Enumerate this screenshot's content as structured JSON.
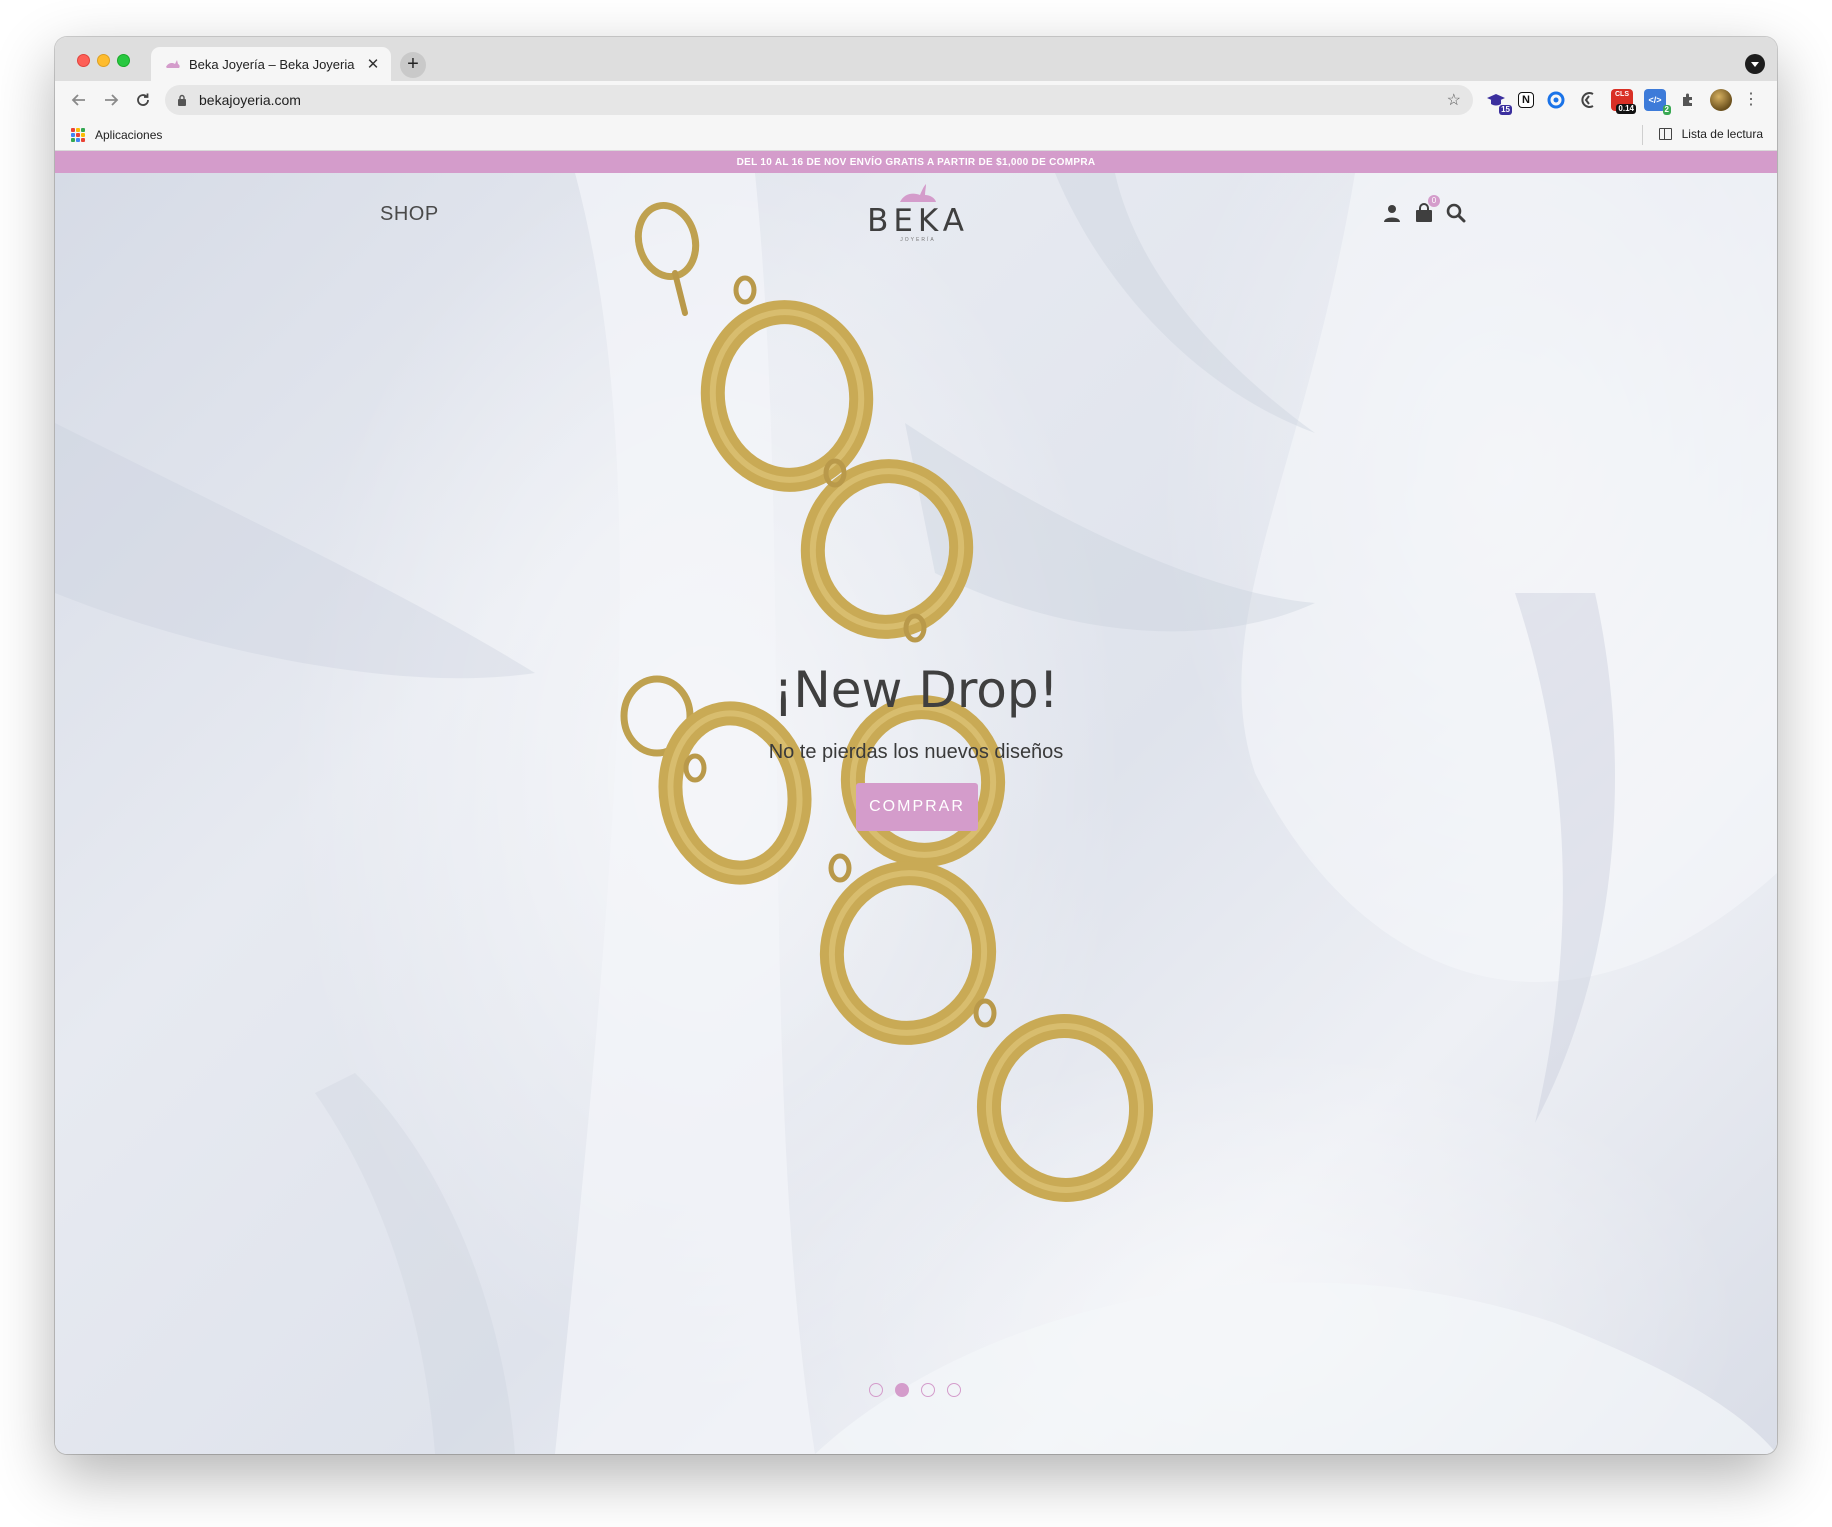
{
  "browser": {
    "tab_title": "Beka Joyería – Beka Joyeria",
    "tab_close": "✕",
    "new_tab": "+",
    "url": "bekajoyeria.com",
    "bookmark_apps": "Aplicaciones",
    "reading_list": "Lista de lectura",
    "extensions": [
      {
        "name": "graduation-cap-extension",
        "badge": "15",
        "color": "#3b2f9e"
      },
      {
        "name": "notion-extension",
        "badge": "",
        "color": "#111111"
      },
      {
        "name": "chrome-extension-blue",
        "badge": "",
        "color": "#1a73e8"
      },
      {
        "name": "mercury-extension",
        "badge": "",
        "color": "#444444"
      },
      {
        "name": "cls-extension",
        "label": "CLS",
        "badge": "0.14",
        "color": "#d93025"
      },
      {
        "name": "code-extension",
        "badge": "2",
        "color": "#3d7bd9"
      }
    ]
  },
  "site": {
    "announcement": "DEL 10 AL 16 DE NOV ENVÍO GRATIS A PARTIR DE $1,000 DE COMPRA",
    "nav_shop": "SHOP",
    "logo": "BEKA",
    "logo_sub": "JOYERÍA",
    "cart_count": "0",
    "accent_color": "#d49ccb"
  },
  "hero": {
    "title": "¡New Drop!",
    "subtitle": "No te pierdas los nuevos diseños",
    "button": "COMPRAR",
    "slides": 4,
    "active_slide": 2
  }
}
